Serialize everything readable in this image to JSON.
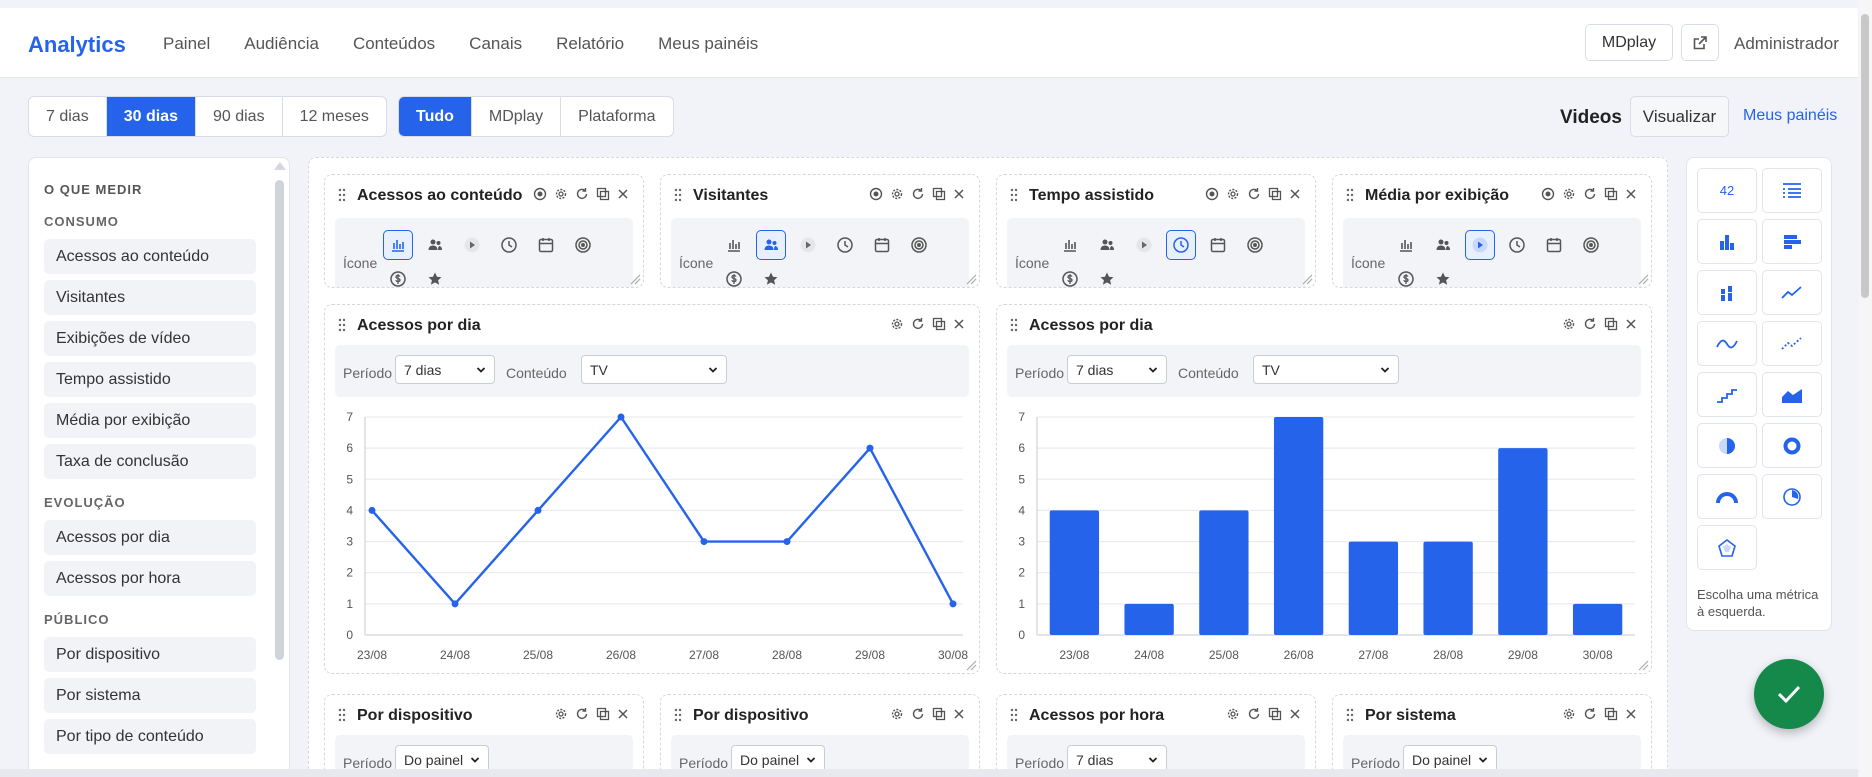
{
  "nav": {
    "brand": "Analytics",
    "items": [
      "Painel",
      "Audiência",
      "Conteúdos",
      "Canais",
      "Relatório",
      "Meus painéis"
    ],
    "site_button": "MDplay",
    "user": "Administrador"
  },
  "filters": {
    "periods": [
      "7 dias",
      "30 dias",
      "90 dias",
      "12 meses"
    ],
    "active_period": "30 dias",
    "sources": [
      "Tudo",
      "MDplay",
      "Plataforma"
    ],
    "active_source": "Tudo",
    "section_title": "Videos",
    "visualize_button": "Visualizar",
    "my_panels_link": "Meus painéis"
  },
  "sidebar": {
    "title": "O QUE MEDIR",
    "sections": [
      {
        "label": "CONSUMO",
        "items": [
          "Acessos ao conteúdo",
          "Visitantes",
          "Exibições de vídeo",
          "Tempo assistido",
          "Média por exibição",
          "Taxa de conclusão"
        ]
      },
      {
        "label": "EVOLUÇÃO",
        "items": [
          "Acessos por dia",
          "Acessos por hora"
        ]
      },
      {
        "label": "PÚBLICO",
        "items": [
          "Por dispositivo",
          "Por sistema",
          "Por tipo de conteúdo"
        ]
      }
    ]
  },
  "kpi_widgets": [
    {
      "title": "Acessos ao conteúdo",
      "icon_label": "Ícone",
      "selected_icon": "bar-chart"
    },
    {
      "title": "Visitantes",
      "icon_label": "Ícone",
      "selected_icon": "users"
    },
    {
      "title": "Tempo assistido",
      "icon_label": "Ícone",
      "selected_icon": "clock"
    },
    {
      "title": "Média por exibição",
      "icon_label": "Ícone",
      "selected_icon": "play"
    }
  ],
  "chart_widgets": [
    {
      "title": "Acessos por dia",
      "period_label": "Período",
      "period_value": "7 dias",
      "content_label": "Conteúdo",
      "content_value": "TV"
    },
    {
      "title": "Acessos por dia",
      "period_label": "Período",
      "period_value": "7 dias",
      "content_label": "Conteúdo",
      "content_value": "TV"
    }
  ],
  "bottom_widgets": [
    {
      "title": "Por dispositivo",
      "period_label": "Período",
      "period_value": "Do painel"
    },
    {
      "title": "Por dispositivo",
      "period_label": "Período",
      "period_value": "Do painel"
    },
    {
      "title": "Acessos por hora",
      "period_label": "Período",
      "period_value": "7 dias"
    },
    {
      "title": "Por sistema",
      "period_label": "Período",
      "period_value": "Do painel"
    }
  ],
  "palette": {
    "number_tile": "42",
    "hint": "Escolha uma métrica à esquerda."
  },
  "colors": {
    "accent": "#2563eb",
    "success": "#14894a"
  },
  "chart_data": [
    {
      "type": "line",
      "categories": [
        "23/08",
        "24/08",
        "25/08",
        "26/08",
        "27/08",
        "28/08",
        "29/08",
        "30/08"
      ],
      "values": [
        4,
        1,
        4,
        7,
        3,
        3,
        6,
        1
      ],
      "yticks": [
        "0",
        "1",
        "2",
        "3",
        "4",
        "5",
        "6",
        "7"
      ],
      "ylim": [
        0,
        7
      ],
      "grid": true,
      "color": "#2563eb"
    },
    {
      "type": "bar",
      "categories": [
        "23/08",
        "24/08",
        "25/08",
        "26/08",
        "27/08",
        "28/08",
        "29/08",
        "30/08"
      ],
      "values": [
        4,
        1,
        4,
        7,
        3,
        3,
        6,
        1
      ],
      "yticks": [
        "0",
        "1",
        "2",
        "3",
        "4",
        "5",
        "6",
        "7"
      ],
      "ylim": [
        0,
        7
      ],
      "grid": true,
      "color": "#2563eb"
    }
  ]
}
